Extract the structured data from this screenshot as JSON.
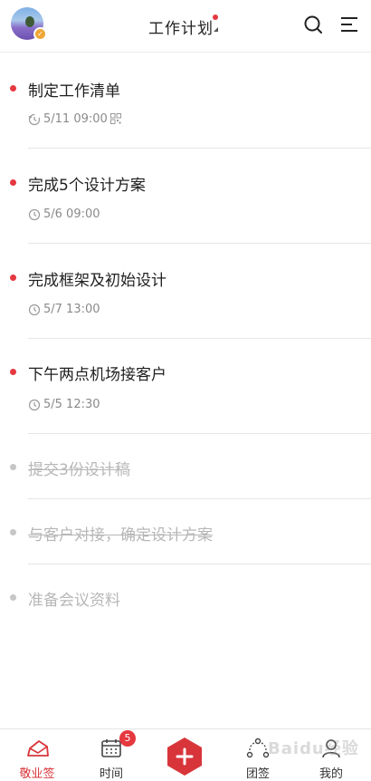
{
  "header": {
    "title": "工作计划",
    "icons": {
      "search": "search-icon",
      "menu": "menu-icon"
    },
    "badge_color": "#e5383f"
  },
  "tasks": [
    {
      "name": "制定工作清单",
      "time": "5/11 09:00",
      "icon": "repeat-clock-icon",
      "extra_icon": "qr-code-icon",
      "status": "active"
    },
    {
      "name": "完成5个设计方案",
      "time": "5/6 09:00",
      "icon": "clock-icon",
      "status": "active"
    },
    {
      "name": "完成框架及初始设计",
      "time": "5/7 13:00",
      "icon": "clock-icon",
      "status": "active"
    },
    {
      "name": "下午两点机场接客户",
      "time": "5/5 12:30",
      "icon": "clock-icon",
      "status": "active"
    },
    {
      "name": "提交3份设计稿",
      "status": "done"
    },
    {
      "name": "与客户对接，确定设计方案",
      "status": "done"
    },
    {
      "name": "准备会议资料",
      "status": "done"
    }
  ],
  "bottom_nav": {
    "items": [
      {
        "label": "敬业签",
        "icon": "note-icon",
        "active": true
      },
      {
        "label": "时间",
        "icon": "calendar-icon",
        "badge": "5"
      },
      {
        "label": "团签",
        "icon": "team-icon"
      },
      {
        "label": "我的",
        "icon": "user-icon"
      }
    ],
    "add_icon": "plus-icon",
    "accent": "#d8353b"
  },
  "watermark": "Baidu经验"
}
